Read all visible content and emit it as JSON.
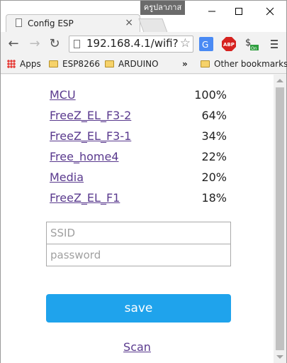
{
  "window": {
    "user_badge": "ครูปลาภาส",
    "tab_title": "Config ESP"
  },
  "toolbar": {
    "url": "192.168.4.1/wifi?"
  },
  "bookmarks": {
    "apps": "Apps",
    "items": [
      "ESP8266",
      "ARDUINO"
    ],
    "overflow": "»",
    "other": "Other bookmarks"
  },
  "networks": [
    {
      "ssid": "MCU",
      "signal": "100%"
    },
    {
      "ssid": "FreeZ_EL_F3-2",
      "signal": "64%"
    },
    {
      "ssid": "FreeZ_EL_F3-1",
      "signal": "34%"
    },
    {
      "ssid": "Free_home4",
      "signal": "22%"
    },
    {
      "ssid": "Media",
      "signal": "20%"
    },
    {
      "ssid": "FreeZ_EL_F1",
      "signal": "18%"
    }
  ],
  "form": {
    "ssid_placeholder": "SSID",
    "password_placeholder": "password",
    "save_label": "save",
    "scan_label": "Scan"
  },
  "colors": {
    "save_button": "#1fa3ec",
    "link": "#5a3a8e"
  }
}
